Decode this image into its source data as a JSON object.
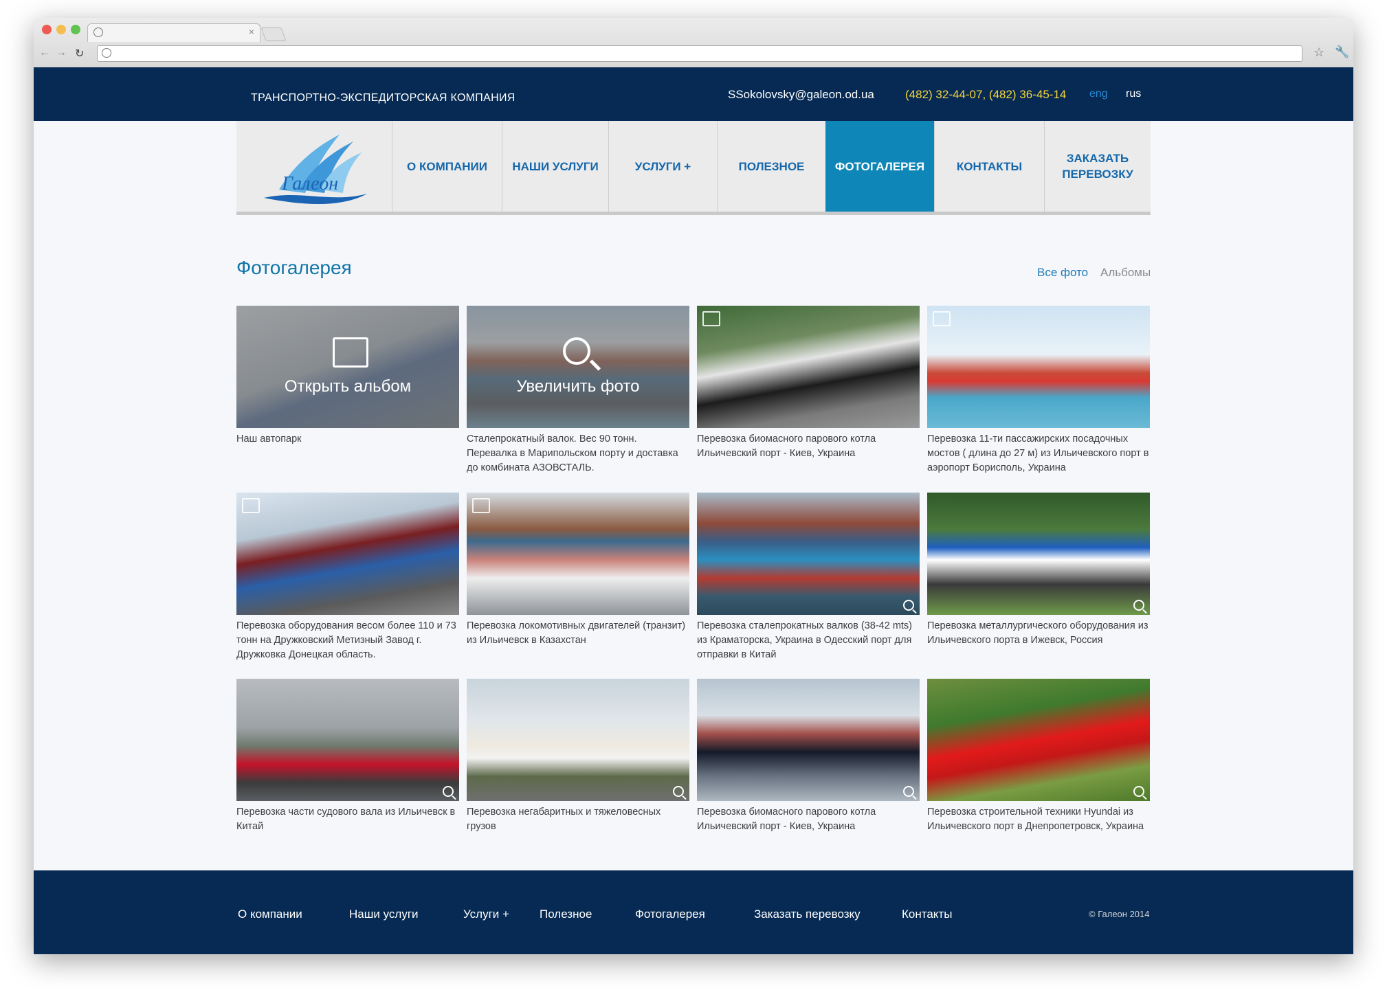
{
  "browser": {
    "tab_close": "×",
    "back": "←",
    "forward": "→",
    "reload": "↻",
    "star": "☆",
    "wrench": "🔧"
  },
  "topbar": {
    "company": "ТРАНСПОРТНО-ЭКСПЕДИТОРСКАЯ КОМПАНИЯ",
    "email": "SSokolovsky@galeon.od.ua",
    "phone": "(482) 32-44-07, (482) 36-45-14",
    "lang_eng": "eng",
    "lang_rus": "rus"
  },
  "nav": {
    "logo_text": "Галеон",
    "items": [
      "О КОМПАНИИ",
      "НАШИ УСЛУГИ",
      "УСЛУГИ +",
      "ПОЛЕЗНОЕ",
      "ФОТОГАЛЕРЕЯ",
      "КОНТАКТЫ",
      "ЗАКАЗАТЬ ПЕРЕВОЗКУ"
    ],
    "active": "ФОТОГАЛЕРЕЯ"
  },
  "gallery": {
    "title": "Фотогалерея",
    "filter_all": "Все фото",
    "filter_albums": "Альбомы",
    "overlay_open": "Открыть альбом",
    "overlay_zoom": "Увеличить фото",
    "items": [
      {
        "caption": "Наш автопарк"
      },
      {
        "caption": "Сталепрокатный валок. Вес 90 тонн. Перевалка в Марипольском порту и доставка до комбината АЗОВСТАЛЬ."
      },
      {
        "caption": "Перевозка биомасного парового котла Ильичевский порт - Киев, Украина"
      },
      {
        "caption": "Перевозка 11-ти пассажирских посадочных мостов ( длина до 27 м) из Ильичевского порт в аэропорт Борисполь, Украина"
      },
      {
        "caption": "Перевозка оборудования весом более 110 и 73 тонн на Дружковский Метизный Завод г. Дружковка Донецкая область."
      },
      {
        "caption": "Перевозка локомотивных двигателей (транзит) из Ильичевск в Казахстан"
      },
      {
        "caption": "Перевозка сталепрокатных валков (38-42 mts) из Краматорска, Украина в Одесский порт для отправки в Китай"
      },
      {
        "caption": "Перевозка металлургического оборудования из Ильичевского порта в Ижевск, Россия"
      },
      {
        "caption": "Перевозка части судового вала из Ильичевск в Китай"
      },
      {
        "caption": "Перевозка негабаритных и тяжеловесных грузов"
      },
      {
        "caption": "Перевозка биомасного парового котла Ильичевский порт - Киев, Украина"
      },
      {
        "caption": "Перевозка строительной техники Hyundai из Ильичевского порт в Днепропетровск, Украина"
      }
    ]
  },
  "footer": {
    "links": [
      "О компании",
      "Наши услуги",
      "Услуги +",
      "Полезное",
      "Фотогалерея",
      "Заказать перевозку",
      "Контакты"
    ],
    "copyright": "© Галеон 2014"
  },
  "colors": {
    "navy": "#062a53",
    "accent": "#0e87b8",
    "phone_yellow": "#f5d53b",
    "link_blue": "#1467ab"
  }
}
